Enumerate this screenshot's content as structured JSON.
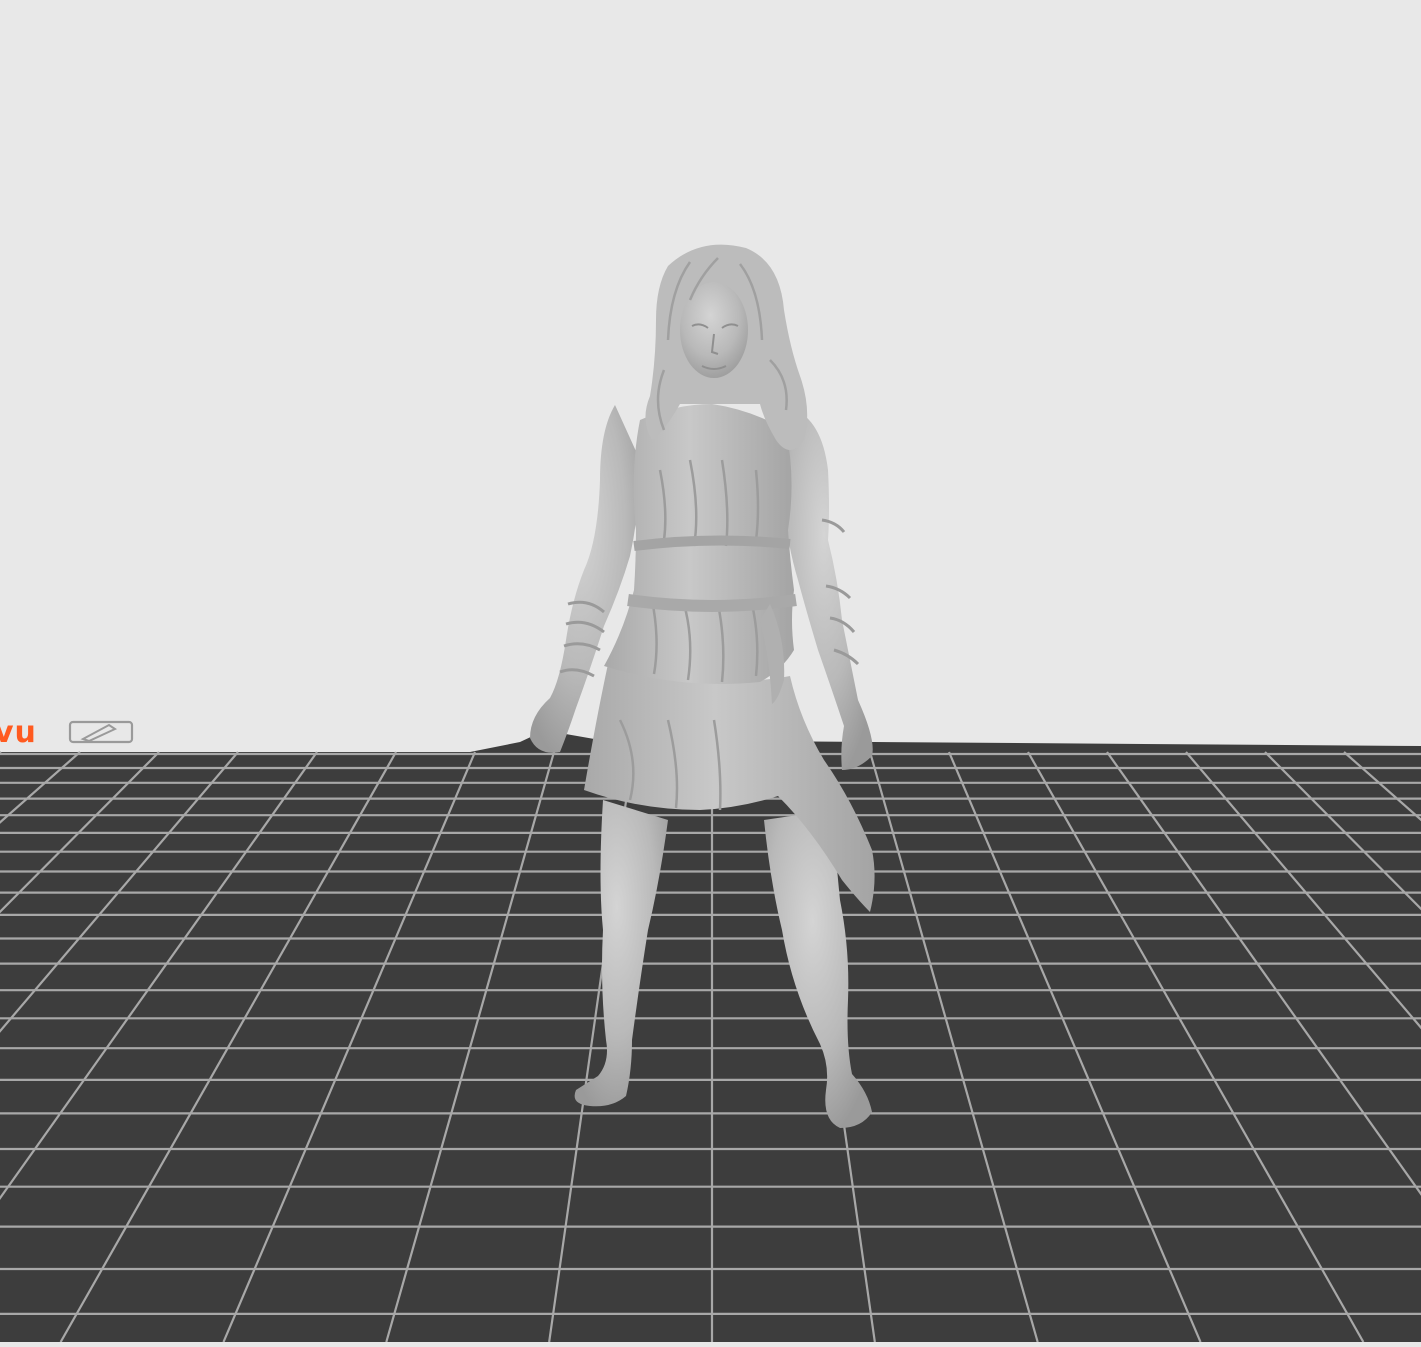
{
  "viewport": {
    "background_color": "#e8e8e8",
    "bed_color": "#3d3d3d",
    "grid_color": "#a8a8a8",
    "model_color": "#b9b9b9",
    "model_shadow_color": "#8f8f8f",
    "model_highlight_color": "#d6d6d6"
  },
  "plate": {
    "name_label": "vu",
    "name_color": "#ff5a1f",
    "edit_icon": "pencil-edit-icon"
  }
}
